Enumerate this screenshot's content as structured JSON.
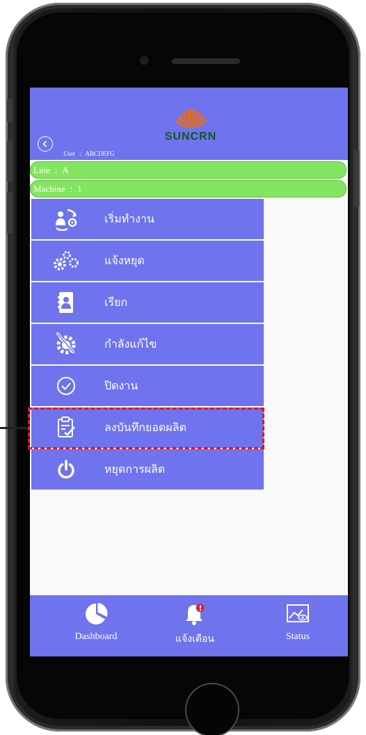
{
  "header": {
    "brand": "SUNCRN",
    "user_label": "User",
    "user_separator": ":",
    "user_name": "ABCDEFG"
  },
  "status": {
    "line_label": "Line",
    "line_value": "A",
    "machine_label": "Machine",
    "machine_value": "1",
    "separator": ":"
  },
  "menu": {
    "items": [
      {
        "label": "เริ่มทำงาน",
        "icon": "start-work-icon"
      },
      {
        "label": "แจ้งหยุด",
        "icon": "gears-icon"
      },
      {
        "label": "เรียก",
        "icon": "contact-book-icon"
      },
      {
        "label": "กำลังแก้ไข",
        "icon": "repair-gear-icon"
      },
      {
        "label": "ปิดงาน",
        "icon": "check-circle-icon"
      },
      {
        "label": "ลงบันทึกยอดผลิต",
        "icon": "clipboard-check-icon"
      },
      {
        "label": "หยุดการผลิต",
        "icon": "power-icon"
      }
    ]
  },
  "tabbar": {
    "dashboard_label": "Dashboard",
    "alert_label": "แจ้งเตือน",
    "status_label": "Status"
  },
  "colors": {
    "primary": "#6f73ee",
    "status_green": "#84e660",
    "logo_orange": "#f06a10",
    "logo_green": "#0e5a1c",
    "highlight_red": "#e8101e"
  }
}
